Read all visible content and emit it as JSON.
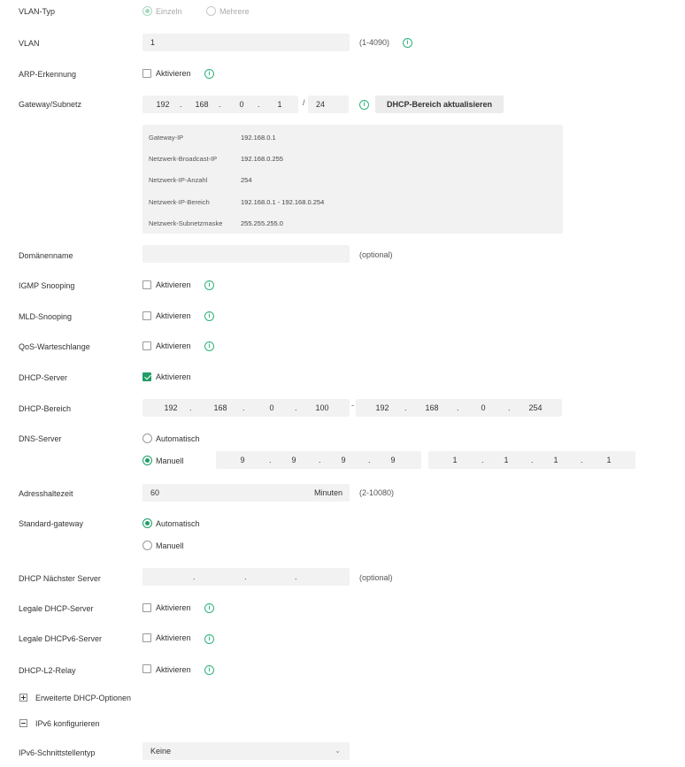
{
  "vlan_typ": {
    "label": "VLAN-Typ",
    "opt_single": "Einzeln",
    "opt_multi": "Mehrere"
  },
  "vlan": {
    "label": "VLAN",
    "value": "1",
    "hint": "(1-4090)"
  },
  "arp": {
    "label": "ARP-Erkennung",
    "checkbox": "Aktivieren"
  },
  "gateway": {
    "label": "Gateway/Subnetz",
    "octets": [
      "192",
      "168",
      "0",
      "1"
    ],
    "slash": "/",
    "prefix": "24",
    "button": "DHCP-Bereich aktualisieren"
  },
  "info": {
    "rows": [
      {
        "key": "Gateway-IP",
        "value": "192.168.0.1"
      },
      {
        "key": "Netzwerk-Broadcast-IP",
        "value": "192.168.0.255"
      },
      {
        "key": "Netzwerk-IP-Anzahl",
        "value": "254"
      },
      {
        "key": "Netzwerk-IP-Bereich",
        "value": "192.168.0.1 - 192.168.0.254"
      },
      {
        "key": "Netzwerk-Subnetzmaske",
        "value": "255.255.255.0"
      }
    ]
  },
  "domain": {
    "label": "Domänenname",
    "value": "",
    "hint": "(optional)"
  },
  "igmp": {
    "label": "IGMP Snooping",
    "checkbox": "Aktivieren"
  },
  "mld": {
    "label": "MLD-Snooping",
    "checkbox": "Aktivieren"
  },
  "qos": {
    "label": "QoS-Warteschlange",
    "checkbox": "Aktivieren"
  },
  "dhcp_server": {
    "label": "DHCP-Server",
    "checkbox": "Aktivieren",
    "checked": true
  },
  "dhcp_range": {
    "label": "DHCP-Bereich",
    "start": [
      "192",
      "168",
      "0",
      "100"
    ],
    "dash": "-",
    "end": [
      "192",
      "168",
      "0",
      "254"
    ]
  },
  "dns": {
    "label": "DNS-Server",
    "opt_auto": "Automatisch",
    "opt_manual": "Manuell",
    "primary": [
      "9",
      "9",
      "9",
      "9"
    ],
    "secondary": [
      "1",
      "1",
      "1",
      "1"
    ]
  },
  "lease": {
    "label": "Adresshaltezeit",
    "value": "60",
    "unit": "Minuten",
    "hint": "(2-10080)"
  },
  "std_gateway": {
    "label": "Standard-gateway",
    "opt_auto": "Automatisch",
    "opt_manual": "Manuell"
  },
  "next_server": {
    "label": "DHCP Nächster Server",
    "hint": "(optional)"
  },
  "legal_dhcp": {
    "label": "Legale DHCP-Server",
    "checkbox": "Aktivieren"
  },
  "legal_dhcpv6": {
    "label": "Legale DHCPv6-Server",
    "checkbox": "Aktivieren"
  },
  "l2relay": {
    "label": "DHCP-L2-Relay",
    "checkbox": "Aktivieren"
  },
  "advanced": {
    "label": "Erweiterte DHCP-Optionen"
  },
  "ipv6": {
    "label": "IPv6 konfigurieren"
  },
  "ipv6_if": {
    "label": "IPv6-Schnittstellentyp",
    "value": "Keine"
  },
  "icons": {
    "info": "info-icon",
    "chevron": "chevron-down-icon"
  },
  "colors": {
    "accent": "#1f9e66",
    "field_bg": "#f2f2f2"
  }
}
